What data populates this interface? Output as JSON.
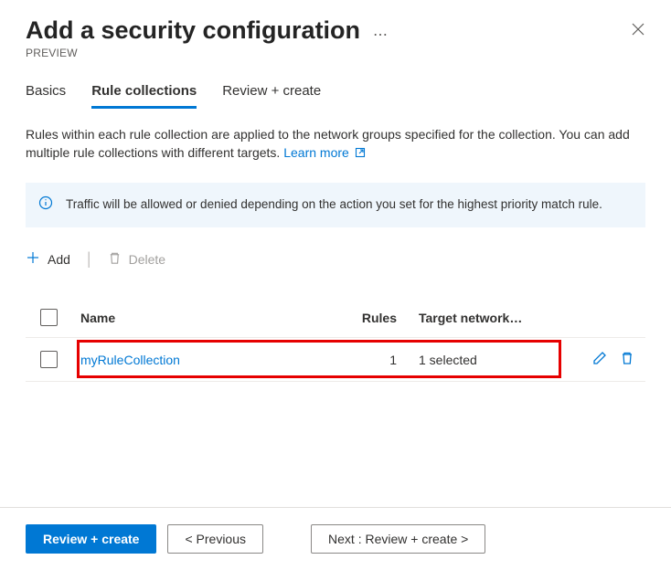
{
  "header": {
    "title": "Add a security configuration",
    "subtitle": "PREVIEW"
  },
  "tabs": [
    {
      "label": "Basics",
      "active": false
    },
    {
      "label": "Rule collections",
      "active": true
    },
    {
      "label": "Review + create",
      "active": false
    }
  ],
  "description": {
    "text": "Rules within each rule collection are applied to the network groups specified for the collection. You can add multiple rule collections with different targets.",
    "learn_more": "Learn more"
  },
  "info_box": {
    "text": "Traffic will be allowed or denied depending on the action you set for the highest priority match rule."
  },
  "toolbar": {
    "add_label": "Add",
    "delete_label": "Delete"
  },
  "table": {
    "columns": {
      "name": "Name",
      "rules": "Rules",
      "target": "Target network…"
    },
    "rows": [
      {
        "name": "myRuleCollection",
        "rules": "1",
        "target": "1 selected"
      }
    ]
  },
  "footer": {
    "review_create": "Review + create",
    "previous": "< Previous",
    "next": "Next : Review + create >"
  }
}
